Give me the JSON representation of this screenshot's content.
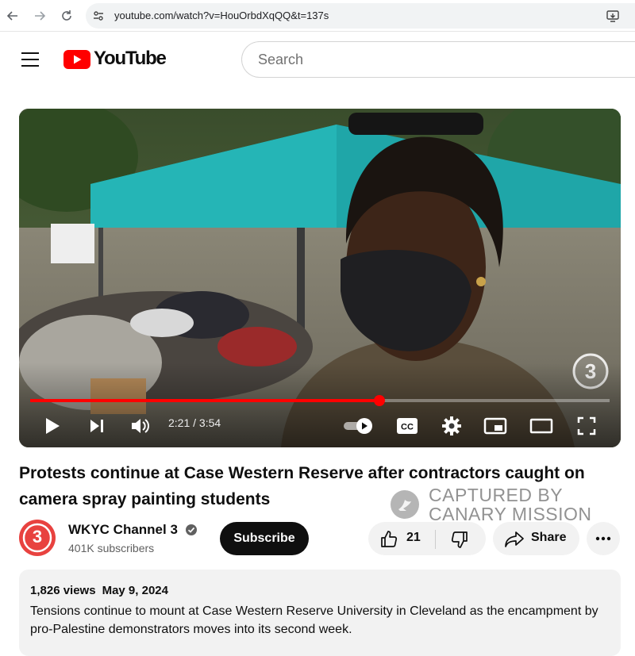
{
  "browser": {
    "url": "youtube.com/watch?v=HouOrbdXqQQ&t=137s"
  },
  "header": {
    "logo_text": "YouTube",
    "search_placeholder": "Search"
  },
  "player": {
    "current_time": "2:21",
    "duration": "3:54",
    "time_display": "2:21 / 3:54",
    "progress_fraction": 0.603,
    "channel_bug": "3",
    "accent_color": "#ff0000"
  },
  "video": {
    "title": "Protests continue at Case Western Reserve after contractors caught on camera spray painting students"
  },
  "watermark": {
    "line1": "CAPTURED BY",
    "line2": "CANARY MISSION"
  },
  "channel": {
    "avatar_text": "3",
    "name": "WKYC Channel 3",
    "subscribers": "401K subscribers",
    "subscribe_label": "Subscribe"
  },
  "actions": {
    "like_count": "21",
    "share_label": "Share"
  },
  "description": {
    "views": "1,826 views",
    "date": "May 9, 2024",
    "text": "Tensions continue to mount at Case Western Reserve University in Cleveland as the encampment by pro-Palestine demonstrators moves into its second week."
  },
  "icons": {
    "back": "arrow-left-icon",
    "forward": "arrow-right-icon",
    "reload": "reload-icon",
    "site_info": "tune-icon",
    "install": "install-app-icon",
    "menu": "hamburger-icon",
    "play": "play-icon",
    "next": "skip-next-icon",
    "volume": "volume-icon",
    "autoplay": "autoplay-toggle-icon",
    "captions": "cc-icon",
    "settings": "gear-icon",
    "miniplayer": "miniplayer-icon",
    "theater": "theater-mode-icon",
    "fullscreen": "fullscreen-icon",
    "verified": "verified-check-icon",
    "like": "thumbs-up-icon",
    "dislike": "thumbs-down-icon",
    "share": "share-arrow-icon",
    "more": "more-horizontal-icon"
  }
}
